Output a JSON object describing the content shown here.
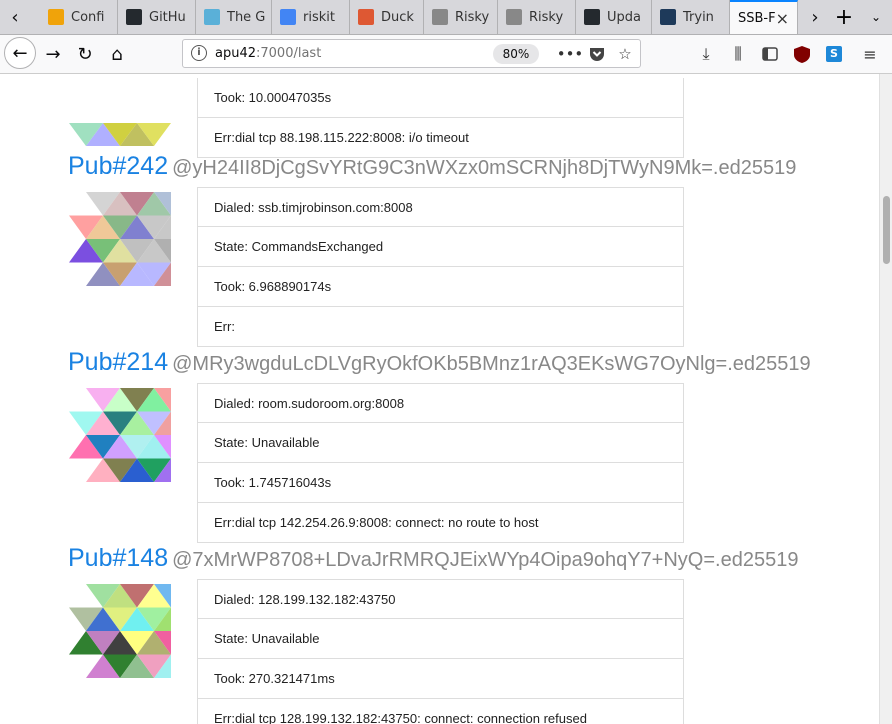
{
  "browser": {
    "tabs": [
      {
        "label": "Confi",
        "icon": "bookmark-icon",
        "color": "#f0a30a"
      },
      {
        "label": "GitHu",
        "icon": "github-icon",
        "color": "#24292e"
      },
      {
        "label": "The G",
        "icon": "page-icon",
        "color": "#5ab0d8"
      },
      {
        "label": "riskit",
        "icon": "google-icon",
        "color": "#4285f4"
      },
      {
        "label": "Duck",
        "icon": "duckduckgo-icon",
        "color": "#de5833"
      },
      {
        "label": "Risky",
        "icon": "page-icon",
        "color": "#888888"
      },
      {
        "label": "Risky",
        "icon": "page-icon",
        "color": "#888888"
      },
      {
        "label": "Upda",
        "icon": "github-icon",
        "color": "#24292e"
      },
      {
        "label": "Tryin",
        "icon": "fediverse-icon",
        "color": "#1e3a5a"
      },
      {
        "label": "SSB-F",
        "icon": "",
        "color": "",
        "active": true
      }
    ],
    "url_host": "apu42",
    "url_rest": ":7000/last",
    "zoom": "80%",
    "icons": [
      "info-icon",
      "more-icon",
      "pocket-icon",
      "bookmark-star-icon",
      "download-icon",
      "library-icon",
      "sidebar-icon",
      "ublock-icon",
      "s-extension-icon",
      "menu-icon"
    ]
  },
  "content": {
    "top_partial": {
      "took": "Took: 10.00047035s",
      "err": "Err:dial tcp 88.198.115.222:8008: i/o timeout"
    },
    "pubs": [
      {
        "name": "Pub#242",
        "key": "@yH24II8DjCgSvYRtG9C3nWXzx0mSCRNjh8DjTWyN9Mk=.ed25519",
        "dialed": "Dialed: ssb.timjrobinson.com:8008",
        "state": "State: CommandsExchanged",
        "took": "Took: 6.968890174s",
        "err": "Err:",
        "colors": [
          "#d4d4d4",
          "#d8c0c0",
          "#c08090",
          "#a0c8a8",
          "#b0c0d8",
          "#ffa0a0",
          "#f0c898",
          "#88b888",
          "#8080d0",
          "#c8c8c8",
          "#c8c8c8",
          "#b0b0e0",
          "#7b4fe0",
          "#78c078",
          "#e0e0a0",
          "#c0c0c0",
          "#c8c8c8",
          "#b0b0b0",
          "#d08040",
          "#9090c0",
          "#c8a070",
          "#b8b8ff",
          "#b8b8ff",
          "#d09098",
          "#c08888"
        ]
      },
      {
        "name": "Pub#214",
        "key": "@MRy3wgduLcDLVgRyOkfOKb5BMnz1rAQ3EKsWG7OyNlg=.ed25519",
        "dialed": "Dialed: room.sudoroom.org:8008",
        "state": "State: Unavailable",
        "took": "Took: 1.745716043s",
        "err": "Err:dial tcp 142.254.26.9:8008: connect: no route to host",
        "colors": [
          "#f8b0f0",
          "#c8ffc8",
          "#808050",
          "#80f0a0",
          "#f8a0a0",
          "#a0f8f0",
          "#ffb0d0",
          "#2a8080",
          "#a8f0a0",
          "#c0c0ff",
          "#f0a0a0",
          "#2a90a0",
          "#ff70b0",
          "#2080c0",
          "#d0a0ff",
          "#b0f0f0",
          "#a0f0f0",
          "#e090ff",
          "#80c080",
          "#ffb0c0",
          "#808050",
          "#2a5fd0",
          "#20a060",
          "#a070f0",
          "#c0a0ff"
        ]
      },
      {
        "name": "Pub#148",
        "key": "@7xMrWP8708+LDvaJrRMRQJEixWYp4Oipa9ohqY7+NyQ=.ed25519",
        "dialed": "Dialed: 128.199.132.182:43750",
        "state": "State: Unavailable",
        "took": "Took: 270.321471ms",
        "err": "Err:dial tcp 128.199.132.182:43750: connect: connection refused",
        "colors": [
          "#a0e0a0",
          "#c0e080",
          "#c07070",
          "#ffff90",
          "#70b8f0",
          "#b0c0a0",
          "#4070d0",
          "#e0f080",
          "#70f0f0",
          "#a0f0a0",
          "#a0e070",
          "#b8b878",
          "#308030",
          "#c080c0",
          "#404040",
          "#ffff80",
          "#b0b070",
          "#f060a0",
          "#70f0f0",
          "#d080d0",
          "#308030",
          "#90c090",
          "#f0a0c0",
          "#a0f0f0",
          "#d090d0"
        ]
      }
    ]
  }
}
